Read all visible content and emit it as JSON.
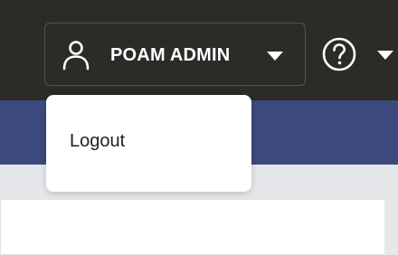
{
  "header": {
    "user_menu": {
      "label": "POAM ADMIN",
      "icon": "user-icon",
      "caret_icon": "caret-down-icon"
    },
    "help_menu": {
      "icon": "help-icon",
      "caret_icon": "caret-down-icon"
    }
  },
  "user_dropdown": {
    "items": [
      {
        "label": "Logout"
      }
    ]
  },
  "colors": {
    "header_background": "#2c2b28",
    "subheader_background": "#3d4a7d",
    "content_background": "#e6e7ea",
    "text_on_dark": "#ffffff"
  }
}
